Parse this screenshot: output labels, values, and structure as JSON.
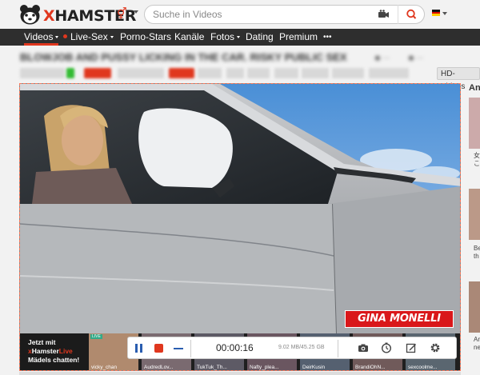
{
  "brand": {
    "name_x": "X",
    "name_rest": "HAMSTER"
  },
  "header": {
    "search_placeholder": "Suche in Videos",
    "gender_icon": "gender-icon",
    "language_flag": "german-flag-icon"
  },
  "nav": {
    "items": [
      {
        "label": "Videos",
        "dropdown": true,
        "active": true
      },
      {
        "label": "Live-Sex",
        "dropdown": true,
        "live": true
      },
      {
        "label": "Porno-Stars"
      },
      {
        "label": "Kanäle"
      },
      {
        "label": "Fotos",
        "dropdown": true
      },
      {
        "label": "Dating"
      },
      {
        "label": "Premium"
      },
      {
        "label": "•••"
      }
    ]
  },
  "video": {
    "title": "BLOWJOB AND PUSSY LICKING IN THE CAR. RISKY PUBLIC SEX",
    "quality_tag": "HD-Videos",
    "watermark": "GINA MONELLI"
  },
  "promo": {
    "line1": "Jetzt mit",
    "brand_x": "x",
    "brand_hamster": "Hamster",
    "brand_live": "Live",
    "line3": "Mädels chatten!"
  },
  "live_cams": [
    {
      "name": "vicky_chan",
      "live": true
    },
    {
      "name": "AudredLov...",
      "live": false
    },
    {
      "name": "TukTuk_Th...",
      "live": false
    },
    {
      "name": "Nafty_plea...",
      "live": false
    },
    {
      "name": "DeirKusin",
      "live": false
    },
    {
      "name": "BrandiOhN...",
      "live": false
    },
    {
      "name": "sexcoolme...",
      "live": false
    }
  ],
  "recorder": {
    "elapsed": "00:00:16",
    "file_size": "9.02 MB/45.25 GB"
  },
  "colors": {
    "brand_red": "#e0371e",
    "nav_bg": "#2e2e2e",
    "control_blue": "#2a5db0"
  }
}
